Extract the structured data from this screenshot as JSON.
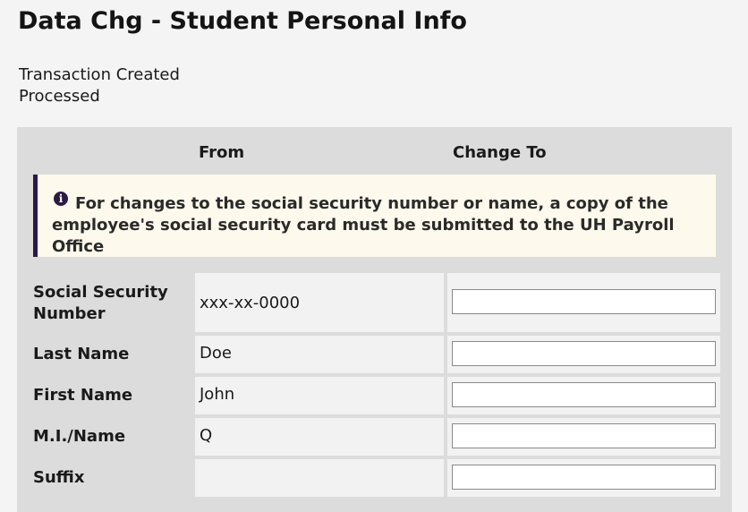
{
  "page": {
    "title": "Data Chg - Student Personal Info",
    "status_lines": [
      "Transaction Created",
      "Processed"
    ]
  },
  "table": {
    "from_header": "From",
    "to_header": "Change To",
    "notice": {
      "icon": "info-icon",
      "text": "For changes to the social security number or name, a copy of the employee's social security card must be submitted to the UH Payroll Office"
    },
    "rows": [
      {
        "label": "Social Security Number",
        "from_value": "xxx-xx-0000",
        "to_value": ""
      },
      {
        "label": "Last Name",
        "from_value": "Doe",
        "to_value": ""
      },
      {
        "label": "First Name",
        "from_value": "John",
        "to_value": ""
      },
      {
        "label": "M.I./Name",
        "from_value": "Q",
        "to_value": ""
      },
      {
        "label": "Suffix",
        "from_value": "",
        "to_value": ""
      }
    ]
  },
  "colors": {
    "page_background": "#f4f4f4",
    "panel_background": "#dcdcdc",
    "notice_background": "#fdf9ec",
    "notice_accent": "#2b1a44"
  }
}
